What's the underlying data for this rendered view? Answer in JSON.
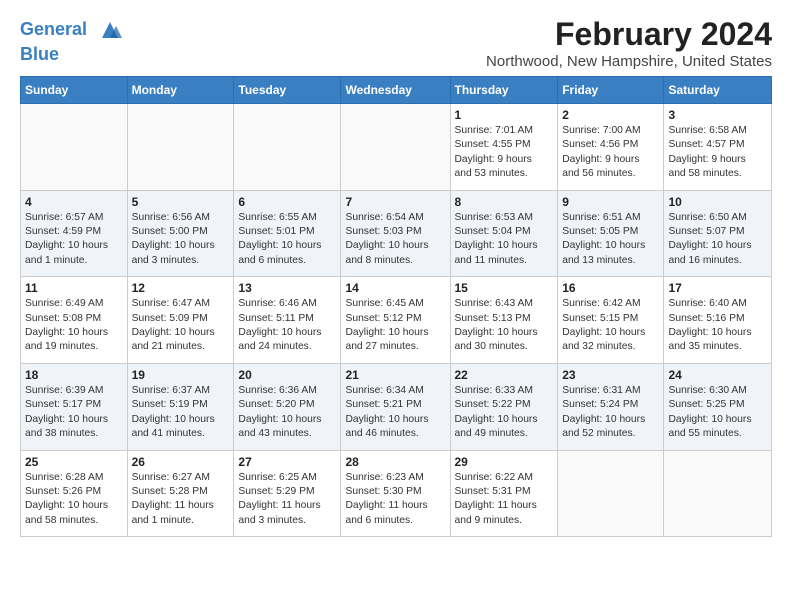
{
  "logo": {
    "line1": "General",
    "line2": "Blue"
  },
  "title": "February 2024",
  "subtitle": "Northwood, New Hampshire, United States",
  "days_header": [
    "Sunday",
    "Monday",
    "Tuesday",
    "Wednesday",
    "Thursday",
    "Friday",
    "Saturday"
  ],
  "weeks": [
    [
      {
        "day": "",
        "info": ""
      },
      {
        "day": "",
        "info": ""
      },
      {
        "day": "",
        "info": ""
      },
      {
        "day": "",
        "info": ""
      },
      {
        "day": "1",
        "info": "Sunrise: 7:01 AM\nSunset: 4:55 PM\nDaylight: 9 hours\nand 53 minutes."
      },
      {
        "day": "2",
        "info": "Sunrise: 7:00 AM\nSunset: 4:56 PM\nDaylight: 9 hours\nand 56 minutes."
      },
      {
        "day": "3",
        "info": "Sunrise: 6:58 AM\nSunset: 4:57 PM\nDaylight: 9 hours\nand 58 minutes."
      }
    ],
    [
      {
        "day": "4",
        "info": "Sunrise: 6:57 AM\nSunset: 4:59 PM\nDaylight: 10 hours\nand 1 minute."
      },
      {
        "day": "5",
        "info": "Sunrise: 6:56 AM\nSunset: 5:00 PM\nDaylight: 10 hours\nand 3 minutes."
      },
      {
        "day": "6",
        "info": "Sunrise: 6:55 AM\nSunset: 5:01 PM\nDaylight: 10 hours\nand 6 minutes."
      },
      {
        "day": "7",
        "info": "Sunrise: 6:54 AM\nSunset: 5:03 PM\nDaylight: 10 hours\nand 8 minutes."
      },
      {
        "day": "8",
        "info": "Sunrise: 6:53 AM\nSunset: 5:04 PM\nDaylight: 10 hours\nand 11 minutes."
      },
      {
        "day": "9",
        "info": "Sunrise: 6:51 AM\nSunset: 5:05 PM\nDaylight: 10 hours\nand 13 minutes."
      },
      {
        "day": "10",
        "info": "Sunrise: 6:50 AM\nSunset: 5:07 PM\nDaylight: 10 hours\nand 16 minutes."
      }
    ],
    [
      {
        "day": "11",
        "info": "Sunrise: 6:49 AM\nSunset: 5:08 PM\nDaylight: 10 hours\nand 19 minutes."
      },
      {
        "day": "12",
        "info": "Sunrise: 6:47 AM\nSunset: 5:09 PM\nDaylight: 10 hours\nand 21 minutes."
      },
      {
        "day": "13",
        "info": "Sunrise: 6:46 AM\nSunset: 5:11 PM\nDaylight: 10 hours\nand 24 minutes."
      },
      {
        "day": "14",
        "info": "Sunrise: 6:45 AM\nSunset: 5:12 PM\nDaylight: 10 hours\nand 27 minutes."
      },
      {
        "day": "15",
        "info": "Sunrise: 6:43 AM\nSunset: 5:13 PM\nDaylight: 10 hours\nand 30 minutes."
      },
      {
        "day": "16",
        "info": "Sunrise: 6:42 AM\nSunset: 5:15 PM\nDaylight: 10 hours\nand 32 minutes."
      },
      {
        "day": "17",
        "info": "Sunrise: 6:40 AM\nSunset: 5:16 PM\nDaylight: 10 hours\nand 35 minutes."
      }
    ],
    [
      {
        "day": "18",
        "info": "Sunrise: 6:39 AM\nSunset: 5:17 PM\nDaylight: 10 hours\nand 38 minutes."
      },
      {
        "day": "19",
        "info": "Sunrise: 6:37 AM\nSunset: 5:19 PM\nDaylight: 10 hours\nand 41 minutes."
      },
      {
        "day": "20",
        "info": "Sunrise: 6:36 AM\nSunset: 5:20 PM\nDaylight: 10 hours\nand 43 minutes."
      },
      {
        "day": "21",
        "info": "Sunrise: 6:34 AM\nSunset: 5:21 PM\nDaylight: 10 hours\nand 46 minutes."
      },
      {
        "day": "22",
        "info": "Sunrise: 6:33 AM\nSunset: 5:22 PM\nDaylight: 10 hours\nand 49 minutes."
      },
      {
        "day": "23",
        "info": "Sunrise: 6:31 AM\nSunset: 5:24 PM\nDaylight: 10 hours\nand 52 minutes."
      },
      {
        "day": "24",
        "info": "Sunrise: 6:30 AM\nSunset: 5:25 PM\nDaylight: 10 hours\nand 55 minutes."
      }
    ],
    [
      {
        "day": "25",
        "info": "Sunrise: 6:28 AM\nSunset: 5:26 PM\nDaylight: 10 hours\nand 58 minutes."
      },
      {
        "day": "26",
        "info": "Sunrise: 6:27 AM\nSunset: 5:28 PM\nDaylight: 11 hours\nand 1 minute."
      },
      {
        "day": "27",
        "info": "Sunrise: 6:25 AM\nSunset: 5:29 PM\nDaylight: 11 hours\nand 3 minutes."
      },
      {
        "day": "28",
        "info": "Sunrise: 6:23 AM\nSunset: 5:30 PM\nDaylight: 11 hours\nand 6 minutes."
      },
      {
        "day": "29",
        "info": "Sunrise: 6:22 AM\nSunset: 5:31 PM\nDaylight: 11 hours\nand 9 minutes."
      },
      {
        "day": "",
        "info": ""
      },
      {
        "day": "",
        "info": ""
      }
    ]
  ]
}
